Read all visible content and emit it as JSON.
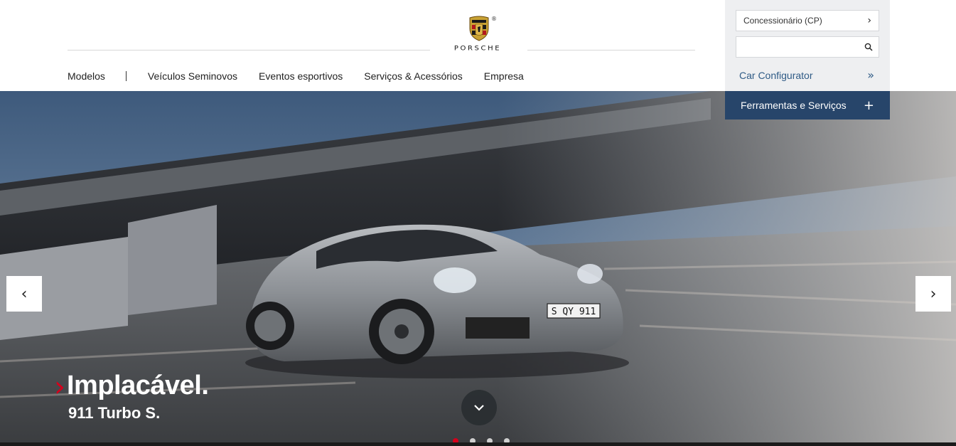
{
  "brand": {
    "wordmark": "PORSCHE",
    "registered": "®"
  },
  "nav": {
    "models": "Modelos",
    "used": "Veículos Seminovos",
    "events": "Eventos esportivos",
    "services": "Serviços & Acessórios",
    "company": "Empresa"
  },
  "panel": {
    "dealer_label": "Concessionário (CP)",
    "search_value": "",
    "search_placeholder": "",
    "configurator_label": "Car Configurator",
    "tools_label": "Ferramentas e Serviços"
  },
  "hero": {
    "headline": "Implacável.",
    "subheadline": "911 Turbo S.",
    "plate": "S QY 911",
    "slide_count": 4,
    "active_slide": 1
  },
  "colors": {
    "accent_red": "#d5001c",
    "panel_bg": "#eeeff1",
    "tools_bg": "#27456a",
    "link_blue": "#2f5b86"
  },
  "icons": {
    "dealer": "chevron-right-icon",
    "search": "search-icon",
    "configurator": "double-chevron-right-icon",
    "tools": "plus-icon",
    "prev": "chevron-left-icon",
    "next": "chevron-right-icon",
    "scroll": "chevron-down-icon"
  }
}
